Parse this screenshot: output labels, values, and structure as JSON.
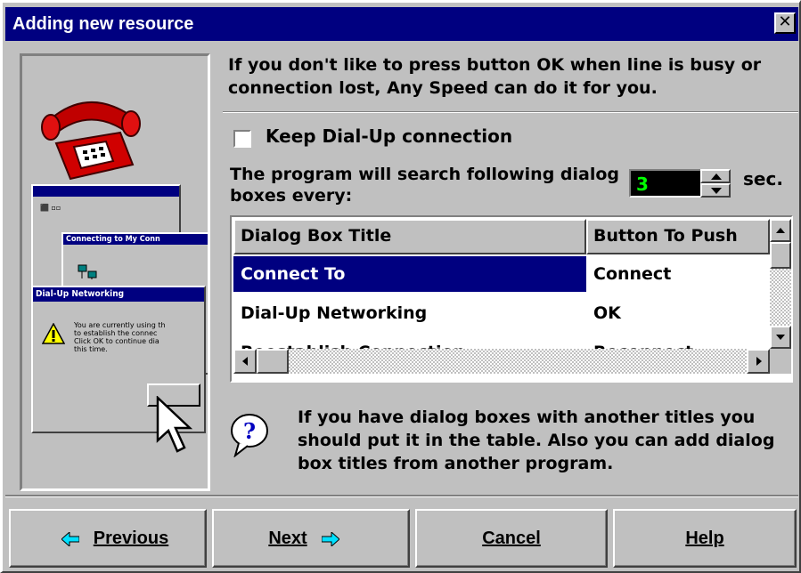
{
  "window": {
    "title": "Adding new resource",
    "close_glyph": "✕"
  },
  "intro": "If you don't like to press button OK when line is busy or connection lost, Any Speed can do it for you.",
  "keep_dialup": {
    "label": "Keep Dial-Up connection",
    "checked": false
  },
  "interval": {
    "label": "The program will search following dialog boxes every:",
    "value": "3",
    "unit": "sec."
  },
  "table": {
    "columns": [
      "Dialog Box Title",
      "Button To Push"
    ],
    "rows": [
      [
        "Connect To",
        "Connect"
      ],
      [
        "Dial-Up Networking",
        "OK"
      ],
      [
        "Reestablish Connection",
        "Reconnect"
      ]
    ],
    "selected_row": 0
  },
  "hint": "If you have dialog boxes with another titles you should put it in the table. Also you can add dialog box titles from another program.",
  "buttons": {
    "previous": "Previous",
    "next": "Next",
    "cancel": "Cancel",
    "help": "Help"
  },
  "illustration": {
    "dialog_title": "Dial-Up Networking",
    "connecting_title": "Connecting to My Conn",
    "msg_lines": [
      "You are currently using th",
      "to establish the connec",
      "Click OK to continue dia",
      "this time."
    ]
  },
  "colors": {
    "titlebar": "#000080",
    "face": "#c0c0c0",
    "spin_value": "#00ff00",
    "hint_arrow": "#00e0ff"
  }
}
